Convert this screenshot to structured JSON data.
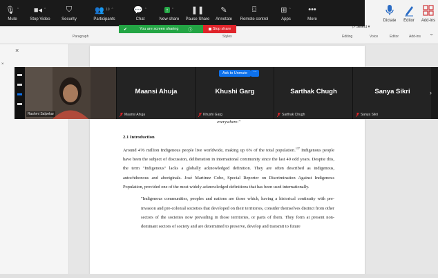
{
  "zoom_toolbar": {
    "buttons": [
      {
        "label": "Mute",
        "icon": "mic-icon"
      },
      {
        "label": "Stop Video",
        "icon": "video-icon"
      },
      {
        "label": "Security",
        "icon": "shield-icon"
      },
      {
        "label": "Participants",
        "icon": "participants-icon",
        "count": "10"
      },
      {
        "label": "Chat",
        "icon": "chat-icon"
      },
      {
        "label": "New share",
        "icon": "share-icon"
      },
      {
        "label": "Pause Share",
        "icon": "pause-icon"
      },
      {
        "label": "Annotate",
        "icon": "pen-icon"
      },
      {
        "label": "Remote control",
        "icon": "mouse-icon"
      },
      {
        "label": "Apps",
        "icon": "apps-icon"
      },
      {
        "label": "More",
        "icon": "more-icon"
      }
    ],
    "share_banner": "You are screen sharing",
    "stop_share": "Stop share",
    "colors": {
      "toolbar_bg": "#1a1a1a",
      "share_green": "#23a544",
      "stop_red": "#e0242a"
    }
  },
  "ribbon": {
    "groups": {
      "paragraph": "Paragraph",
      "styles": "Styles",
      "editing": "Editing",
      "voice": "Voice",
      "editor": "Editor",
      "addins": "Add-ins"
    },
    "buttons": [
      {
        "label": "Dictate",
        "icon": "microphone-icon"
      },
      {
        "label": "Editor",
        "icon": "editor-pen-icon"
      },
      {
        "label": "Add-ins",
        "icon": "addins-grid-icon"
      }
    ],
    "select_label": "Select"
  },
  "gallery": {
    "self_name": "Rashmi Salpekar",
    "ask_unmute": "Ask to Unmute",
    "more": "···",
    "participants": [
      {
        "name": "Maansi Ahuja",
        "label": "Maansi Ahuja"
      },
      {
        "name": "Khushi Garg",
        "label": "Khushi Garg"
      },
      {
        "name": "Sarthak Chugh",
        "label": "Sarthak Chugh"
      },
      {
        "name": "Sanya Sikri",
        "label": "Sanya Sikri"
      }
    ]
  },
  "document": {
    "fragment": "everywhere.\"",
    "heading": "2.1 Introduction",
    "para1_a": "Around 476 million Indigenous people live worldwide, making up 6% of the total population.",
    "para1_sup": "137",
    "para1_b": " Indigenous people have been the subject of discussion, deliberation in international community since the last 40 odd years. Despite this, the term \"Indigenous\" lacks a globally acknowledged definition. They are often described as indigenous, autochthonous and aboriginals. José Martinez Cobo, Special Reporter on Discrimination Against Indigenous Population, provided one of the most widely acknowledged definitions that has been used internationally.",
    "quote": "\"Indigenous communities, peoples and nations are those which, having a historical continuity with pre-invasion and pre-colonial societies that developed on their territories, consider themselves distinct from other sectors of the societies now prevailing in those territories, or parts of them. They form at present non-dominant sectors of society and are determined to preserve, develop and transmit to future"
  },
  "left_pane": {
    "close": "×"
  }
}
